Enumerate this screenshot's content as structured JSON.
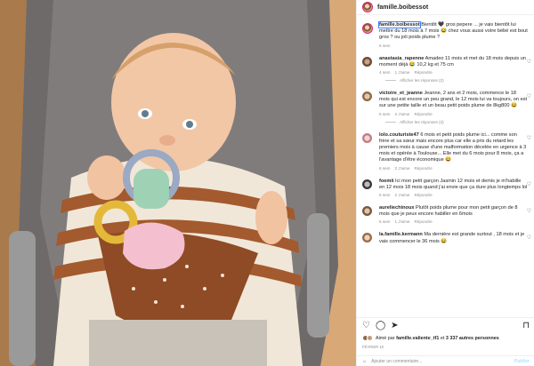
{
  "post": {
    "username": "famille.boibessot",
    "caption": {
      "user": "famille.boibessot",
      "text": " Bientôt 🖤 gros pepere ... je vais bientôt lui mettre du 18 mois à 7 mois 😂 chez vous aussi votre bébé est bout gros ? ou joli poids plume ?",
      "age": "6 sem"
    },
    "comments": [
      {
        "user": "anastasia_rapenne",
        "text": " Amadeo 11 mois et met du 18 mois depuis un moment déjà 😂 10,2 kg et 75 cm",
        "age": "4 sem",
        "likes": "1 J'aime",
        "reply": "Répondre",
        "replies": "Afficher les réponses (2)"
      },
      {
        "user": "victoire_et_jeanne",
        "text": " Jeanne, 2 ans et 2 mois, commence le 18 mois qui est encore un peu grand, le 12 mois lui va toujours, on est sur une petite taille et un beau petit poids plume de 8kg800 😂",
        "age": "5 sem",
        "likes": "3 J'aime",
        "reply": "Répondre",
        "replies": "Afficher les réponses (3)"
      },
      {
        "user": "lolo.couturiste47",
        "text": " 6 mois et petit poids plume ici... comme son frère et sa sœur mais encore plus car elle a pris du retard les premiers mois à cause d'une malformation décelée en urgence à 3 mois et opérée à Toulouse... Elle met du 6 mois pour 8 mois, ça a l'avantage d'être économique 😂",
        "age": "6 sem",
        "likes": "2 J'aime",
        "reply": "Répondre",
        "replies": ""
      },
      {
        "user": "foemii",
        "text": " Ici mon petit garçon Jasmin 12 mois et demis je m'habille en 12 mois 18 mois quand j'ai envie que ça dure plus longtemps lol",
        "age": "5 sem",
        "likes": "2 J'aime",
        "reply": "Répondre",
        "replies": ""
      },
      {
        "user": "aureliechinoux",
        "text": " Plutôt poids plume pour mon petit garçon de 8 mois que je peux encore habiller en 6mois",
        "age": "5 sem",
        "likes": "1 J'aime",
        "reply": "Répondre",
        "replies": ""
      },
      {
        "user": "la.famille.kermann",
        "text": " Ma dernière est grande surtout , 18 mois et je vais commencer le 36 mois 😂",
        "age": "",
        "likes": "",
        "reply": "",
        "replies": ""
      }
    ],
    "likes": {
      "prefix": "Aimé par ",
      "user": "famille.valiente_tf1",
      "middle": " et ",
      "count": "3 337 autres personnes"
    },
    "date": "FÉVRIER 10",
    "add_comment": {
      "placeholder": "Ajouter un commentaire...",
      "publish": "Publier"
    }
  }
}
